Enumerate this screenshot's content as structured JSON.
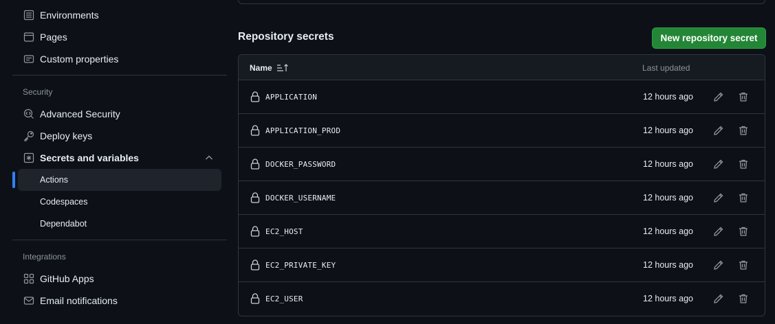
{
  "sidebar": {
    "top_items": [
      {
        "label": "Environments",
        "icon": "environments-icon"
      },
      {
        "label": "Pages",
        "icon": "pages-icon"
      },
      {
        "label": "Custom properties",
        "icon": "custom-properties-icon"
      }
    ],
    "security": {
      "title": "Security",
      "items": [
        {
          "label": "Advanced Security",
          "icon": "codescan-icon"
        },
        {
          "label": "Deploy keys",
          "icon": "key-icon"
        },
        {
          "label": "Secrets and variables",
          "icon": "asterisk-icon",
          "expanded": true
        }
      ],
      "subitems": [
        {
          "label": "Actions",
          "active": true
        },
        {
          "label": "Codespaces",
          "active": false
        },
        {
          "label": "Dependabot",
          "active": false
        }
      ]
    },
    "integrations": {
      "title": "Integrations",
      "items": [
        {
          "label": "GitHub Apps",
          "icon": "apps-icon"
        },
        {
          "label": "Email notifications",
          "icon": "mail-icon"
        }
      ]
    }
  },
  "main": {
    "heading": "Repository secrets",
    "new_button_label": "New repository secret",
    "table": {
      "col_name": "Name",
      "col_updated": "Last updated",
      "rows": [
        {
          "name": "APPLICATION",
          "updated": "12 hours ago"
        },
        {
          "name": "APPLICATION_PROD",
          "updated": "12 hours ago"
        },
        {
          "name": "DOCKER_PASSWORD",
          "updated": "12 hours ago"
        },
        {
          "name": "DOCKER_USERNAME",
          "updated": "12 hours ago"
        },
        {
          "name": "EC2_HOST",
          "updated": "12 hours ago"
        },
        {
          "name": "EC2_PRIVATE_KEY",
          "updated": "12 hours ago"
        },
        {
          "name": "EC2_USER",
          "updated": "12 hours ago"
        }
      ]
    }
  },
  "colors": {
    "background": "#0d1117",
    "border": "#30363d",
    "accent_blue": "#2f81f7",
    "primary_green": "#238636",
    "muted_text": "#8b949e"
  }
}
